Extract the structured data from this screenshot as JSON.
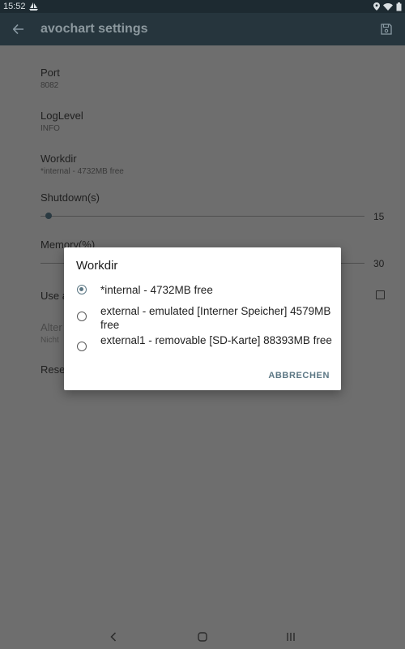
{
  "status_bar": {
    "time": "15:52",
    "icons": [
      "sailboat-icon",
      "location-icon",
      "wifi-icon",
      "battery-icon"
    ]
  },
  "app_bar": {
    "title": "avochart settings",
    "back_icon": "arrow-back-icon",
    "save_icon": "save-icon"
  },
  "settings": {
    "port": {
      "title": "Port",
      "summary": "8082"
    },
    "loglevel": {
      "title": "LogLevel",
      "summary": "INFO"
    },
    "workdir": {
      "title": "Workdir",
      "summary": "*internal -  4732MB free"
    },
    "shutdown": {
      "title": "Shutdown(s)",
      "value": "15",
      "fraction": 0.025
    },
    "memory": {
      "title": "Memory(%)",
      "value": "30"
    },
    "use": {
      "title": "Use a",
      "checked": false
    },
    "alter": {
      "title": "Alter",
      "summary": "Nicht"
    },
    "reset": {
      "title": "Rese"
    }
  },
  "dialog": {
    "title": "Workdir",
    "options": [
      {
        "label": "*internal -  4732MB free",
        "selected": true
      },
      {
        "label": "external -  emulated [Interner Speicher] 4579MB free",
        "selected": false
      },
      {
        "label": "external1 -  removable [SD-Karte] 88393MB free",
        "selected": false
      }
    ],
    "cancel_label": "ABBRECHEN"
  },
  "colors": {
    "accent": "#5c7784",
    "app_bar": "#26353d",
    "status_bar": "#1d2a31",
    "scrim": "#6e6e6e"
  },
  "nav_bar": {
    "icons": [
      "nav-back-icon",
      "nav-home-icon",
      "nav-recents-icon"
    ]
  }
}
